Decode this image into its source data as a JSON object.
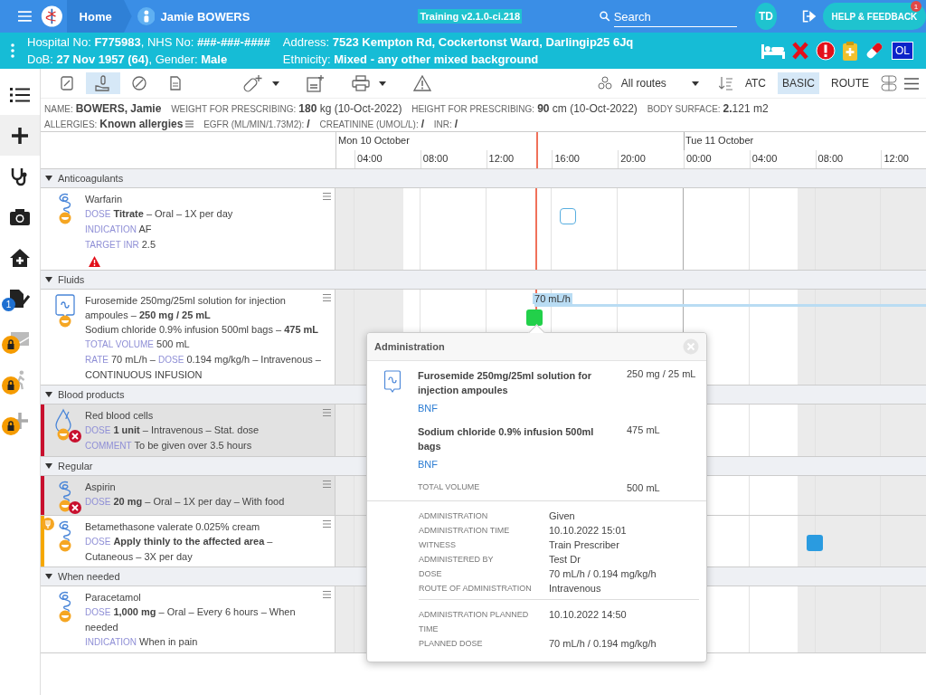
{
  "top_bar": {
    "home": "Home",
    "patient": "Jamie BOWERS",
    "version": "Training v2.1.0-ci.218",
    "search_placeholder": "Search",
    "user_initials": "TD",
    "help": "HELP & FEEDBACK",
    "help_badge": "1"
  },
  "banner": {
    "left": [
      "Hospital No: **F775983**, NHS No: **###-###-####**",
      "DoB: **27 Nov 1957 (64)**, Gender: **Male**"
    ],
    "right": [
      "Address: **7523 Kempton Rd, Cockertonst Ward, Darlingip25 6Jq**",
      "Ethnicity: **Mixed - any other mixed background**"
    ],
    "icons": [
      {
        "kind": "bed"
      },
      {
        "kind": "cross"
      },
      {
        "kind": "alert"
      },
      {
        "kind": "clipboard"
      },
      {
        "kind": "pill"
      },
      {
        "kind": "tag",
        "label": "OL"
      }
    ]
  },
  "sidebar": [
    {
      "kind": "list",
      "selected": false,
      "locked": false
    },
    {
      "kind": "plus",
      "selected": true,
      "locked": false
    },
    {
      "kind": "stethoscope",
      "selected": false,
      "locked": false
    },
    {
      "kind": "camera",
      "selected": false,
      "locked": false
    },
    {
      "kind": "home",
      "selected": false,
      "locked": false
    },
    {
      "kind": "edit",
      "selected": false,
      "locked": false,
      "badge": "1"
    },
    {
      "kind": "message",
      "selected": false,
      "locked": true
    },
    {
      "kind": "walk",
      "selected": false,
      "locked": true
    },
    {
      "kind": "plus",
      "selected": false,
      "locked": true
    }
  ],
  "toolbar": {
    "views": [
      {
        "kind": "chart",
        "selected": false
      },
      {
        "kind": "hand",
        "selected": true
      },
      {
        "kind": "pill",
        "selected": false
      },
      {
        "kind": "document",
        "selected": false
      }
    ],
    "actions": [
      {
        "kind": "add-pill",
        "dropdown": true
      },
      {
        "kind": "report",
        "dropdown": false
      },
      {
        "kind": "print",
        "dropdown": true
      },
      {
        "kind": "warning",
        "dropdown": false
      }
    ],
    "routes": "All routes",
    "sort": [
      {
        "label": "ATC",
        "selected": false
      },
      {
        "label": "BASIC",
        "selected": true
      },
      {
        "label": "ROUTE",
        "selected": false
      }
    ]
  },
  "patient_info": [
    {
      "label": "NAME:",
      "value": "BOWERS, Jamie",
      "strong": true
    },
    {
      "label": "WEIGHT FOR PRESCRIBING:",
      "value": "**180** kg (10-Oct-2022)",
      "strong": false
    },
    {
      "label": "HEIGHT FOR PRESCRIBING:",
      "value": "**90** cm (10-Oct-2022)",
      "strong": false
    },
    {
      "label": "BODY SURFACE:",
      "value": "**2.**121 m2",
      "strong": false
    },
    {
      "label": "ALLERGIES:",
      "value": "Known allergies",
      "strong": true,
      "menu": true
    },
    {
      "label": "EGFR (ML/MIN/1.73M2):",
      "value": "/",
      "strong": true
    },
    {
      "label": "CREATININE (UMOL/L):",
      "value": "/",
      "strong": true
    },
    {
      "label": "INR:",
      "value": "/",
      "strong": true
    }
  ],
  "timeline": {
    "days": [
      "Mon 10 October",
      "Tue 11 October"
    ],
    "hours": [
      "04:00",
      "08:00",
      "12:00",
      "16:00",
      "20:00",
      "00:00",
      "04:00",
      "08:00",
      "12:00"
    ],
    "now": {
      "level": 0.339
    }
  },
  "sections": [
    {
      "title": "Anticoagulants",
      "expanded": true,
      "items": [
        {
          "kind": "oral",
          "stopped": false,
          "attention": false,
          "warning": true,
          "lines": [
            [
              {
                "text": "Warfarin"
              }
            ],
            [
              {
                "label": "DOSE"
              },
              {
                "text": "**Titrate** – Oral – 1X per day"
              }
            ],
            [
              {
                "label": "INDICATION"
              },
              {
                "text": "AF"
              }
            ],
            [
              {
                "label": "TARGET INR"
              },
              {
                "text": "2.5"
              }
            ]
          ],
          "markers": [
            {
              "kind": "planned",
              "level": 0.393
            }
          ]
        }
      ]
    },
    {
      "title": "Fluids",
      "expanded": true,
      "items": [
        {
          "kind": "infusion",
          "stopped": false,
          "attention": false,
          "warning": false,
          "lines": [
            [
              {
                "text": "Furosemide 250mg/25ml solution for injection ampoules – **250 mg / 25 mL**"
              }
            ],
            [
              {
                "text": "Sodium chloride 0.9% infusion 500ml bags – **475 mL**"
              }
            ],
            [
              {
                "label": "TOTAL VOLUME"
              },
              {
                "text": "500 mL"
              }
            ],
            [
              {
                "label": "RATE"
              },
              {
                "text": "70 mL/h –"
              },
              {
                "label": "DOSE"
              },
              {
                "text": "0.194 mg/kg/h – Intravenous – CONTINUOUS INFUSION"
              }
            ]
          ],
          "markers": [
            {
              "kind": "rate",
              "level": 0.337,
              "label": "70 mL/h"
            },
            {
              "kind": "given",
              "level": 0.337
            }
          ]
        }
      ]
    },
    {
      "title": "Blood products",
      "expanded": true,
      "items": [
        {
          "kind": "blood",
          "stopped": true,
          "attention": false,
          "warning": false,
          "lines": [
            [
              {
                "text": "Red blood cells"
              }
            ],
            [
              {
                "label": "DOSE"
              },
              {
                "text": "**1 unit** – Intravenous – Stat. dose"
              }
            ],
            [
              {
                "label": "COMMENT"
              },
              {
                "text": "To be given over 3.5 hours"
              }
            ]
          ]
        }
      ]
    },
    {
      "title": "Regular",
      "expanded": true,
      "items": [
        {
          "kind": "oral",
          "stopped": true,
          "attention": false,
          "warning": false,
          "lines": [
            [
              {
                "text": "Aspirin"
              }
            ],
            [
              {
                "label": "DOSE"
              },
              {
                "text": "**20 mg** – Oral – 1X per day – With food"
              }
            ]
          ]
        },
        {
          "kind": "oral",
          "stopped": false,
          "attention": true,
          "warning": false,
          "lines": [
            [
              {
                "text": "Betamethasone valerate 0.025% cream"
              }
            ],
            [
              {
                "label": "DOSE"
              },
              {
                "text": "**Apply thinly to the affected area** – Cutaneous – 3X per day"
              }
            ]
          ],
          "markers": [
            {
              "kind": "due",
              "level": 0.811
            }
          ]
        }
      ]
    },
    {
      "title": "When needed",
      "expanded": true,
      "items": [
        {
          "kind": "oral",
          "stopped": false,
          "attention": false,
          "warning": false,
          "lines": [
            [
              {
                "text": "Paracetamol"
              }
            ],
            [
              {
                "label": "DOSE"
              },
              {
                "text": "**1,000 mg** – Oral – Every 6 hours – When needed"
              }
            ],
            [
              {
                "label": "INDICATION"
              },
              {
                "text": "When in pain"
              }
            ]
          ]
        }
      ]
    }
  ],
  "popup": {
    "title": "Administration",
    "products": [
      {
        "name": "Furosemide 250mg/25ml solution for injection ampoules",
        "amount": "250 mg / 25 mL",
        "link": "BNF"
      },
      {
        "name": "Sodium chloride 0.9% infusion 500ml bags",
        "amount": "475 mL",
        "link": "BNF"
      }
    ],
    "total": {
      "label": "TOTAL VOLUME",
      "value": "500 mL"
    },
    "details": [
      [
        {
          "label": "ADMINISTRATION",
          "value": "Given"
        },
        {
          "label": "ADMINISTRATION TIME",
          "value": "10.10.2022 15:01"
        },
        {
          "label": "WITNESS",
          "value": "Train Prescriber"
        },
        {
          "label": "ADMINISTERED BY",
          "value": "Test Dr"
        },
        {
          "label": "DOSE",
          "value": "70 mL/h / 0.194 mg/kg/h"
        },
        {
          "label": "ROUTE OF ADMINISTRATION",
          "value": "Intravenous"
        }
      ],
      [
        {
          "label": "ADMINISTRATION PLANNED TIME",
          "value": "10.10.2022 14:50"
        },
        {
          "label": "PLANNED DOSE",
          "value": "70 mL/h / 0.194 mg/kg/h"
        }
      ]
    ]
  }
}
